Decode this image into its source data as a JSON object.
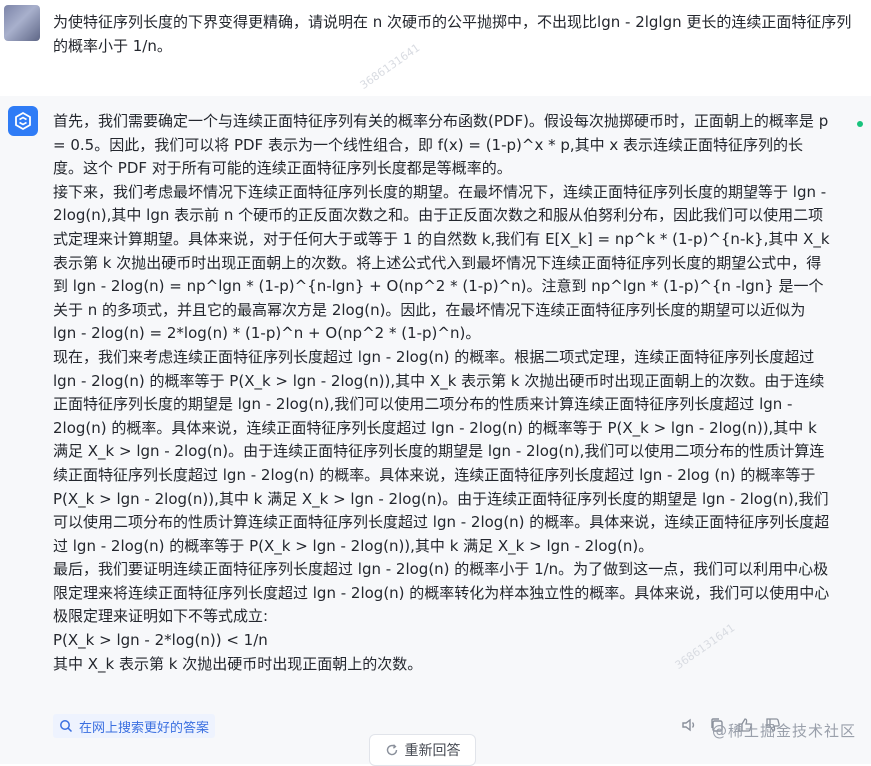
{
  "question": {
    "text": "为使特征序列长度的下界变得更精确，请说明在 n 次硬币的公平抛掷中，不出现比lgn - 2lglgn 更长的连续正面特征序列的概率小于 1/n。"
  },
  "answer": {
    "paragraphs": [
      "首先，我们需要确定一个与连续正面特征序列有关的概率分布函数(PDF)。假设每次抛掷硬币时，正面朝上的概率是 p = 0.5。因此，我们可以将 PDF 表示为一个线性组合，即 f(x) = (1-p)^x * p,其中 x 表示连续正面特征序列的长度。这个 PDF 对于所有可能的连续正面特征序列长度都是等概率的。",
      "接下来，我们考虑最坏情况下连续正面特征序列长度的期望。在最坏情况下，连续正面特征序列长度的期望等于 lgn - 2log(n),其中 lgn 表示前 n 个硬币的正反面次数之和。由于正反面次数之和服从伯努利分布，因此我们可以使用二项式定理来计算期望。具体来说，对于任何大于或等于 1 的自然数 k,我们有 E[X_k] = np^k * (1-p)^{n-k},其中 X_k 表示第 k 次抛出硬币时出现正面朝上的次数。将上述公式代入到最坏情况下连续正面特征序列长度的期望公式中，得到 lgn - 2log(n) = np^lgn * (1-p)^{n-lgn} + O(np^2 * (1-p)^n)。注意到 np^lgn * (1-p)^{n -lgn} 是一个关于 n 的多项式，并且它的最高幂次方是 2log(n)。因此，在最坏情况下连续正面特征序列长度的期望可以近似为 lgn - 2log(n) = 2*log(n) * (1-p)^n + O(np^2 * (1-p)^n)。",
      "现在，我们来考虑连续正面特征序列长度超过 lgn - 2log(n) 的概率。根据二项式定理，连续正面特征序列长度超过 lgn - 2log(n) 的概率等于 P(X_k > lgn - 2log(n)),其中 X_k 表示第 k 次抛出硬币时出现正面朝上的次数。由于连续正面特征序列长度的期望是 lgn - 2log(n),我们可以使用二项分布的性质来计算连续正面特征序列长度超过 lgn - 2log(n) 的概率。具体来说，连续正面特征序列长度超过 lgn - 2log(n) 的概率等于 P(X_k > lgn - 2log(n)),其中 k 满足 X_k > lgn - 2log(n)。由于连续正面特征序列长度的期望是 lgn - 2log(n),我们可以使用二项分布的性质计算连续正面特征序列长度超过 lgn - 2log(n) 的概率。具体来说，连续正面特征序列长度超过 lgn - 2log (n) 的概率等于 P(X_k > lgn - 2log(n)),其中 k 满足 X_k > lgn - 2log(n)。由于连续正面特征序列长度的期望是 lgn - 2log(n),我们可以使用二项分布的性质计算连续正面特征序列长度超过 lgn - 2log(n) 的概率。具体来说，连续正面特征序列长度超过 lgn - 2log(n) 的概率等于 P(X_k > lgn - 2log(n)),其中 k 满足 X_k > lgn - 2log(n)。",
      "最后，我们要证明连续正面特征序列长度超过 lgn - 2log(n) 的概率小于 1/n。为了做到这一点，我们可以利用中心极限定理来将连续正面特征序列长度超过 lgn - 2log(n) 的概率转化为样本独立性的概率。具体来说，我们可以使用中心极限定理来证明如下不等式成立:",
      "P(X_k > lgn - 2*log(n)) < 1/n",
      "其中 X_k 表示第 k 次抛出硬币时出现正面朝上的次数。"
    ]
  },
  "footer": {
    "search_link": "在网上搜索更好的答案",
    "regenerate_label": "重新回答",
    "watermark": "@稀土掘金技术社区",
    "id_watermark": "3686131641"
  },
  "icons": {
    "search": "search-icon",
    "regenerate": "refresh-icon",
    "bot": "assistant-logo-icon",
    "actions": [
      "speaker-icon",
      "copy-icon",
      "thumb-up-icon",
      "thumb-down-icon"
    ]
  },
  "colors": {
    "accent": "#2f7cf6",
    "link": "#3a6fe0",
    "status": "#19c37d",
    "answer_bg": "#f7f8fa"
  }
}
